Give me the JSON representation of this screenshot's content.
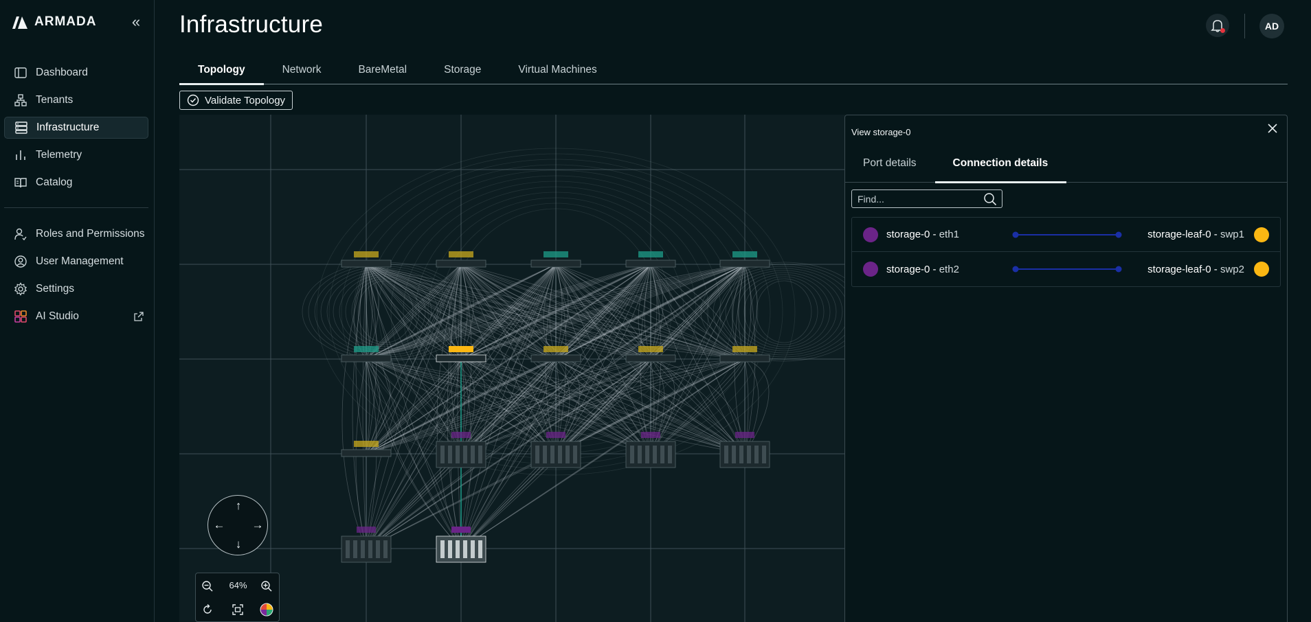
{
  "app": {
    "brand": "ARMADA"
  },
  "sidebar": {
    "items": [
      {
        "label": "Dashboard",
        "icon": "dashboard-icon"
      },
      {
        "label": "Tenants",
        "icon": "tenants-icon"
      },
      {
        "label": "Infrastructure",
        "icon": "infrastructure-icon",
        "active": true
      },
      {
        "label": "Telemetry",
        "icon": "telemetry-icon"
      },
      {
        "label": "Catalog",
        "icon": "catalog-icon"
      }
    ],
    "items2": [
      {
        "label": "Roles and Permissions",
        "icon": "roles-icon"
      },
      {
        "label": "User Management",
        "icon": "user-management-icon"
      },
      {
        "label": "Settings",
        "icon": "gear-icon"
      },
      {
        "label": "AI Studio",
        "icon": "ai-studio-icon",
        "external": true
      }
    ]
  },
  "header": {
    "title": "Infrastructure",
    "avatar": "AD"
  },
  "tabs": [
    {
      "label": "Topology",
      "active": true
    },
    {
      "label": "Network"
    },
    {
      "label": "BareMetal"
    },
    {
      "label": "Storage"
    },
    {
      "label": "Virtual Machines"
    }
  ],
  "toolbar": {
    "validate_label": "Validate Topology"
  },
  "canvas": {
    "zoom": "64%",
    "selected_node": "storage-0"
  },
  "panel": {
    "title": "View storage-0",
    "tabs": [
      {
        "label": "Port details"
      },
      {
        "label": "Connection details",
        "active": true
      }
    ],
    "find_placeholder": "Find...",
    "connections": [
      {
        "src": "storage-0",
        "src_port": "eth1",
        "dst": "storage-leaf-0",
        "dst_port": "swp1"
      },
      {
        "src": "storage-0",
        "src_port": "eth2",
        "dst": "storage-leaf-0",
        "dst_port": "swp2"
      }
    ]
  },
  "colors": {
    "background": "#061619",
    "canvas": "#0d1d21",
    "source_dot": "#6b2488",
    "dest_dot": "#fbb713",
    "link_line": "#1a2fa6",
    "leaf_label": "#c9a91c",
    "spine_label": "#1e9d8a",
    "server_label": "#6b2488"
  }
}
